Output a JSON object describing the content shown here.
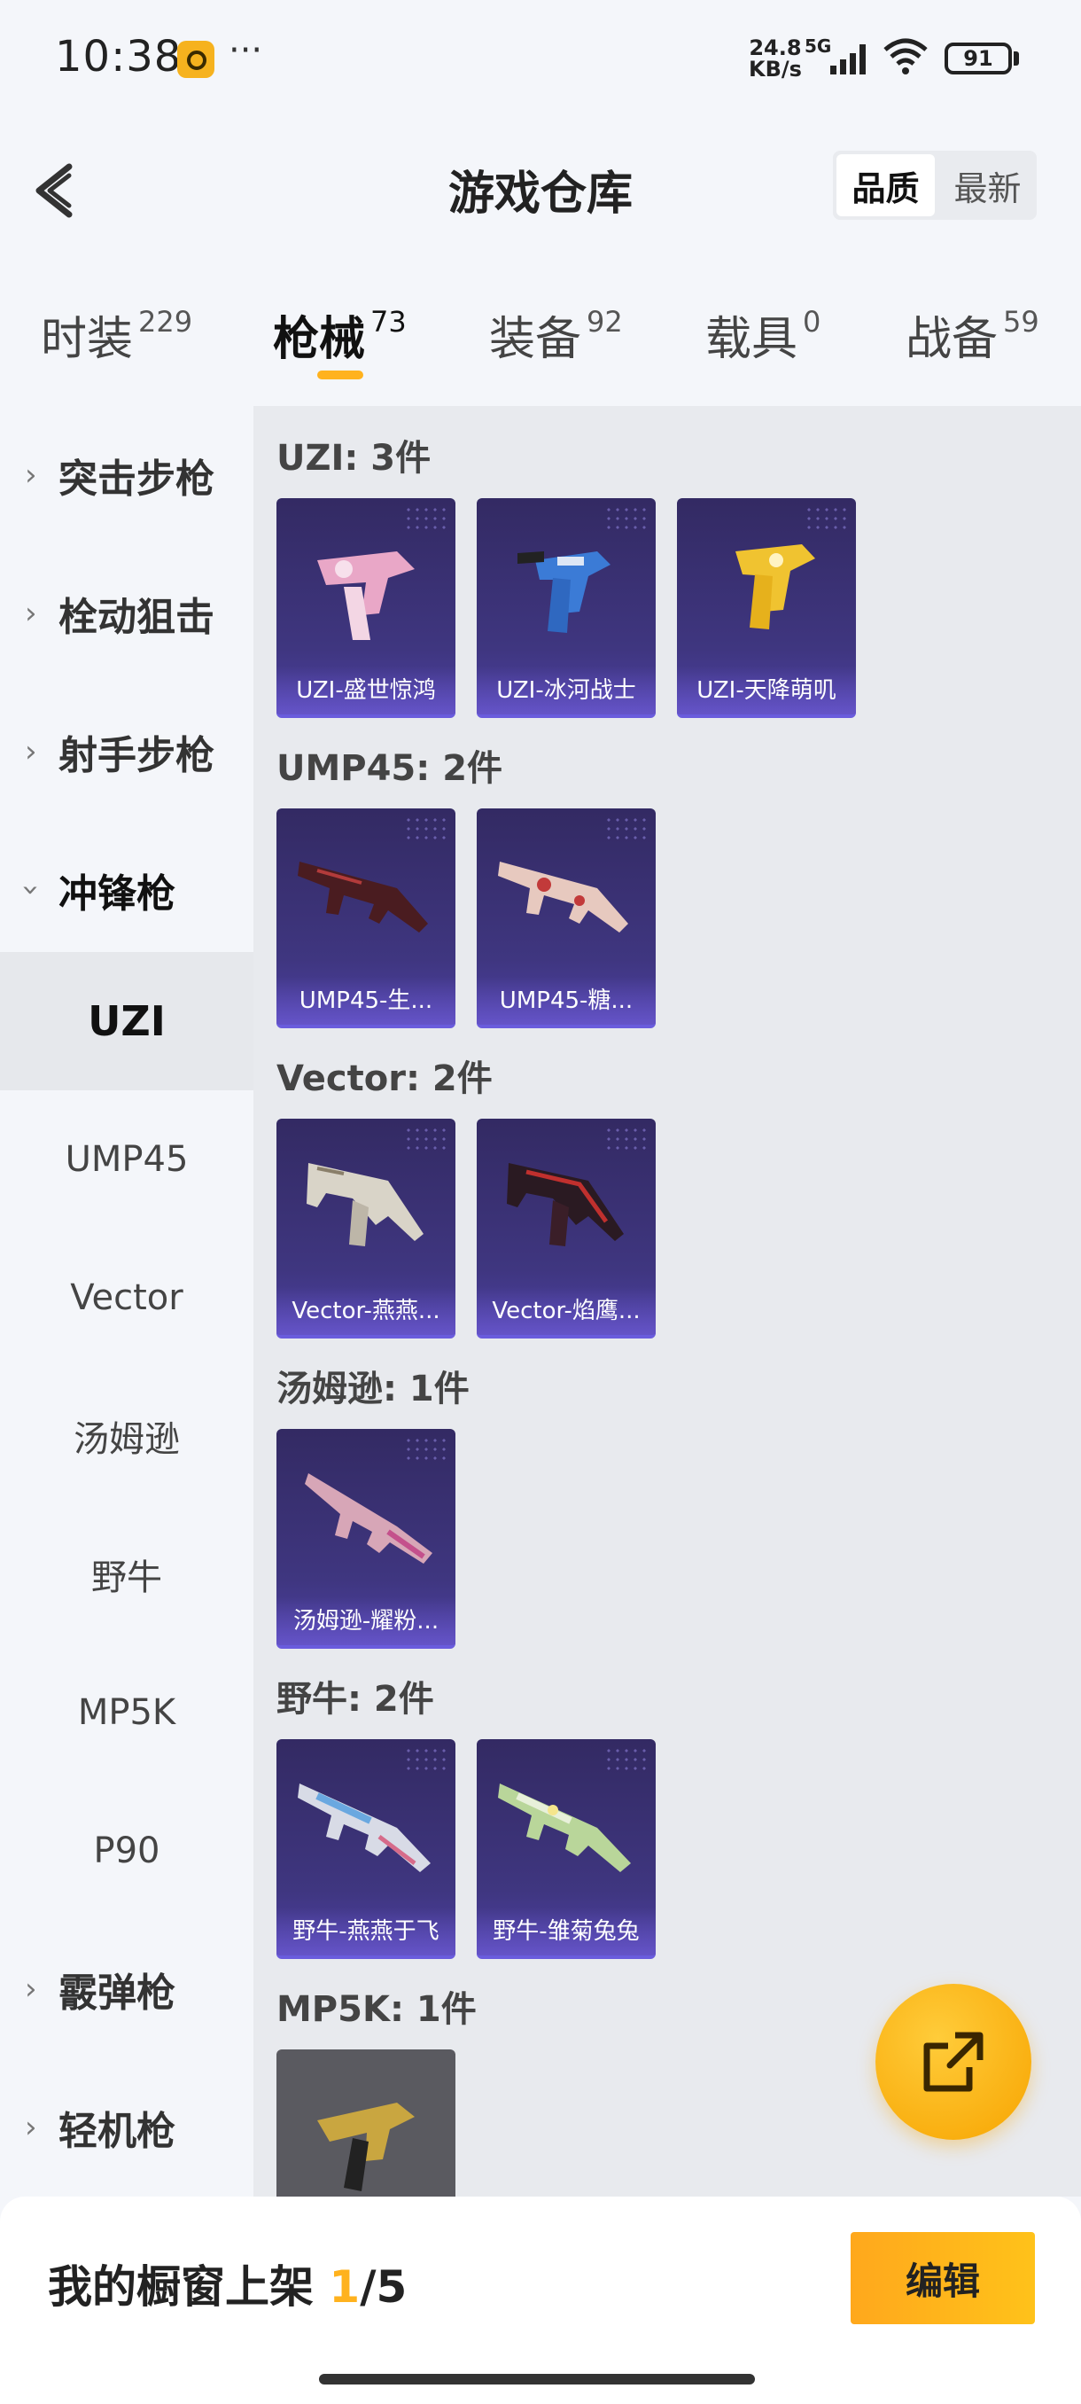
{
  "status_bar": {
    "time": "10:38",
    "more": "···",
    "speed_value": "24.8",
    "speed_unit": "KB/s",
    "network": "5G",
    "battery": "91"
  },
  "header": {
    "title": "游戏仓库",
    "sort_options": [
      "品质",
      "最新"
    ]
  },
  "tabs": [
    {
      "label": "时装",
      "count": "229"
    },
    {
      "label": "枪械",
      "count": "73"
    },
    {
      "label": "装备",
      "count": "92"
    },
    {
      "label": "载具",
      "count": "0"
    },
    {
      "label": "战备",
      "count": "59"
    }
  ],
  "sidebar": {
    "categories": [
      {
        "label": "突击步枪",
        "expanded": false
      },
      {
        "label": "栓动狙击",
        "expanded": false
      },
      {
        "label": "射手步枪",
        "expanded": false
      },
      {
        "label": "冲锋枪",
        "expanded": true
      },
      {
        "label": "霰弹枪",
        "expanded": false
      },
      {
        "label": "轻机枪",
        "expanded": false
      }
    ],
    "subitems": [
      "UZI",
      "UMP45",
      "Vector",
      "汤姆逊",
      "野牛",
      "MP5K",
      "P90"
    ],
    "active_subitem": "UZI"
  },
  "groups": [
    {
      "title": "UZI: 3件",
      "items": [
        "UZI-盛世惊鸿",
        "UZI-冰河战士",
        "UZI-天降萌叽"
      ]
    },
    {
      "title": "UMP45: 2件",
      "items": [
        "UMP45-生...",
        "UMP45-糖..."
      ]
    },
    {
      "title": "Vector: 2件",
      "items": [
        "Vector-燕燕...",
        "Vector-焰鹰..."
      ]
    },
    {
      "title": "汤姆逊: 1件",
      "items": [
        "汤姆逊-耀粉..."
      ]
    },
    {
      "title": "野牛: 2件",
      "items": [
        "野牛-燕燕于飞",
        "野牛-雏菊兔兔"
      ]
    },
    {
      "title": "MP5K: 1件",
      "items": [
        ""
      ]
    }
  ],
  "bottom": {
    "showcase_prefix": "我的橱窗上架 ",
    "showcase_count": "1",
    "showcase_total": "/5",
    "edit_label": "编辑"
  },
  "colors": {
    "accent": "#ffb21e",
    "card_bg": "#3a3175",
    "card_border": "#6a5cdd"
  }
}
